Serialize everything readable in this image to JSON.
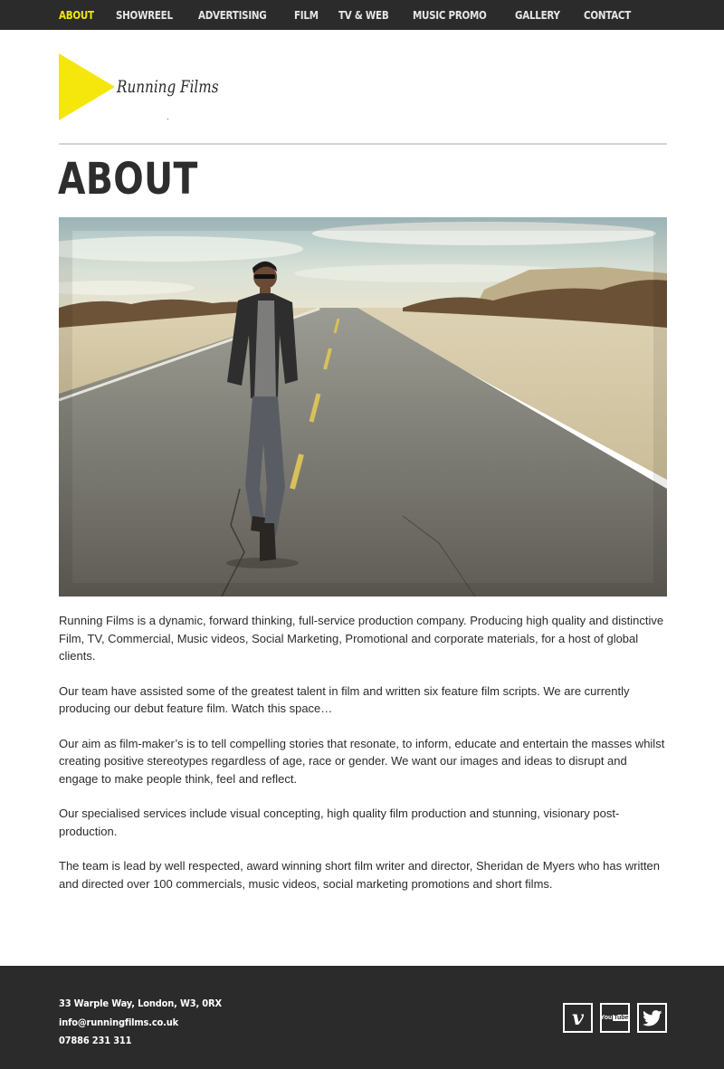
{
  "nav": {
    "items": [
      {
        "label": "ABOUT",
        "active": true
      },
      {
        "label": "SHOWREEL",
        "active": false
      },
      {
        "label": "ADVERTISING",
        "active": false
      },
      {
        "label": "FILM",
        "active": false
      },
      {
        "label": "TV & WEB",
        "active": false
      },
      {
        "label": "MUSIC PROMO",
        "active": false
      },
      {
        "label": "GALLERY",
        "active": false
      },
      {
        "label": "CONTACT",
        "active": false
      }
    ]
  },
  "logo": {
    "text": "Running Films",
    "icon": "play-triangle-icon"
  },
  "page": {
    "title": "ABOUT"
  },
  "hero": {
    "image": "man-walking-on-desert-road-photo"
  },
  "content": {
    "paragraphs": [
      "Running Films is a dynamic, forward thinking, full-service production company. Producing high quality and distinctive Film, TV, Commercial, Music videos, Social Marketing, Promotional and corporate materials, for a host of global clients.",
      "Our team have assisted some of the greatest talent in film and written six feature film scripts. We are currently producing our debut feature film. Watch this space…",
      "Our aim as film-maker’s is to tell compelling stories that resonate, to inform, educate and entertain the masses whilst creating positive stereotypes regardless of age, race or gender. We want our images and ideas to disrupt and engage to make people think, feel and reflect.",
      "Our specialised services include visual concepting, high quality film production and stunning, visionary post-production.",
      "The team is lead by well respected, award winning short film writer and director, Sheridan de Myers who has written and directed over 100 commercials, music videos, social marketing promotions and short films."
    ]
  },
  "footer": {
    "address": "33 Warple Way, London, W3, 0RX",
    "email": "info@runningfilms.co.uk",
    "phone": "07886 231 311",
    "social": {
      "vimeo": {
        "glyph": "v",
        "icon": "vimeo-icon"
      },
      "youtube": {
        "you": "You",
        "tube": "Tube",
        "icon": "youtube-icon"
      },
      "twitter": {
        "icon": "twitter-icon"
      }
    }
  },
  "colors": {
    "accent": "#f5e60c",
    "bar": "#2b2b2b",
    "text": "#2b2b2b"
  }
}
